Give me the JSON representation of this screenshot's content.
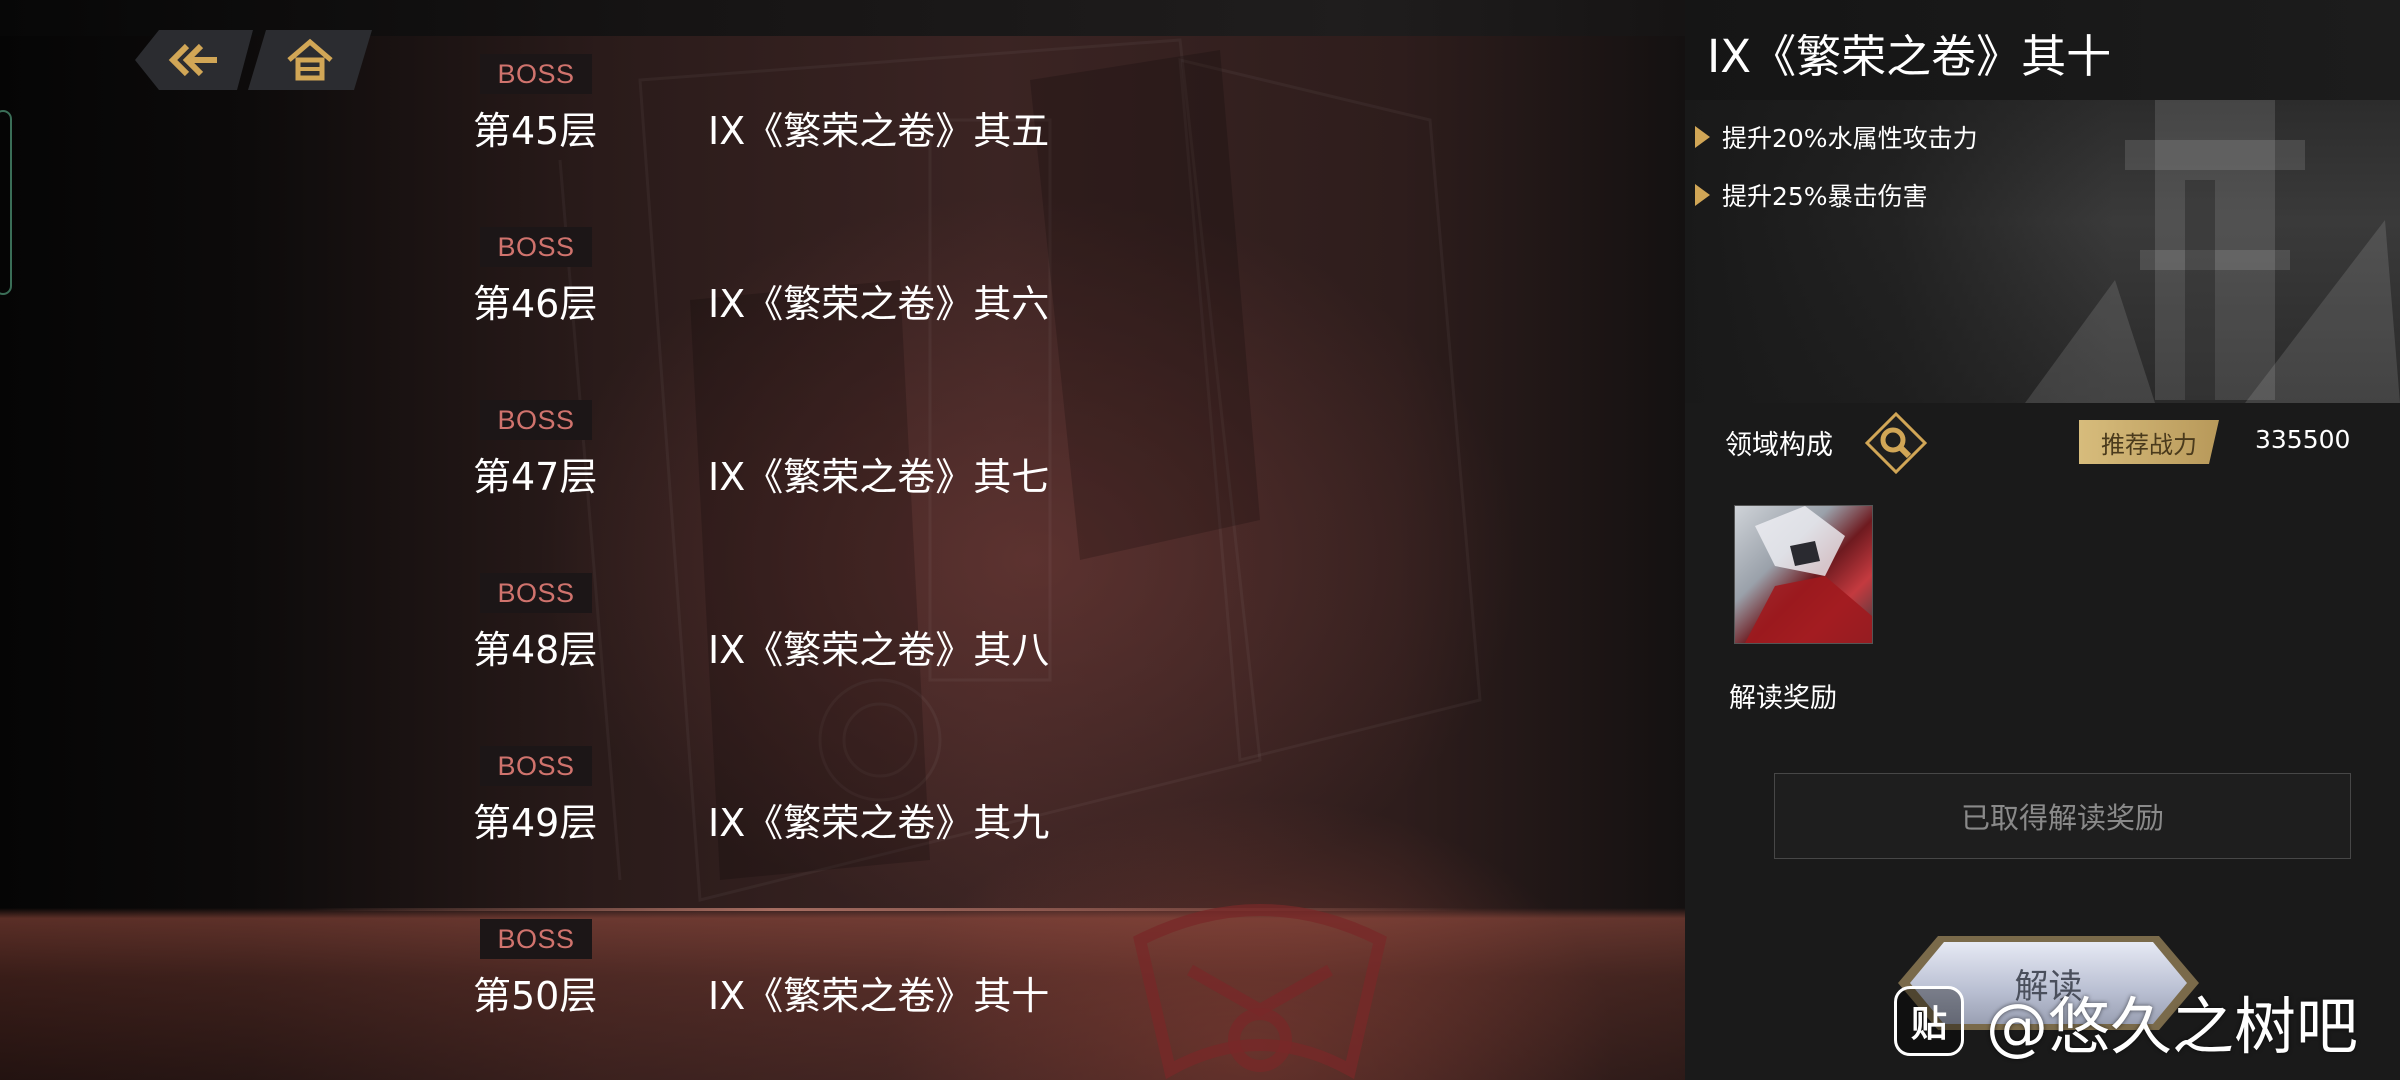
{
  "nav": {
    "back_icon": "back-arrow-icon",
    "home_icon": "home-icon"
  },
  "floors": [
    {
      "badge": "BOSS",
      "floor": "第45层",
      "name": "IX《繁荣之卷》其五",
      "selected": false
    },
    {
      "badge": "BOSS",
      "floor": "第46层",
      "name": "IX《繁荣之卷》其六",
      "selected": false
    },
    {
      "badge": "BOSS",
      "floor": "第47层",
      "name": "IX《繁荣之卷》其七",
      "selected": false
    },
    {
      "badge": "BOSS",
      "floor": "第48层",
      "name": "IX《繁荣之卷》其八",
      "selected": false
    },
    {
      "badge": "BOSS",
      "floor": "第49层",
      "name": "IX《繁荣之卷》其九",
      "selected": false
    },
    {
      "badge": "BOSS",
      "floor": "第50层",
      "name": "IX《繁荣之卷》其十",
      "selected": true
    }
  ],
  "detail": {
    "title": "IX《繁荣之卷》其十",
    "buffs": [
      "提升20%水属性攻击力",
      "提升25%暴击伤害"
    ],
    "domain_label": "领域构成",
    "domain_icon": "magnifier-icon",
    "power_label": "推荐战力",
    "power_value": "335500",
    "reward_label": "解读奖励",
    "claimed_text": "已取得解读奖励",
    "read_button": "解读"
  },
  "colors": {
    "boss_text": "#d0736d",
    "gold_accent": "#d1a656",
    "selected_row": "#a05042"
  },
  "watermark": {
    "logo_text": "贴",
    "text": "@悠久之树吧"
  }
}
